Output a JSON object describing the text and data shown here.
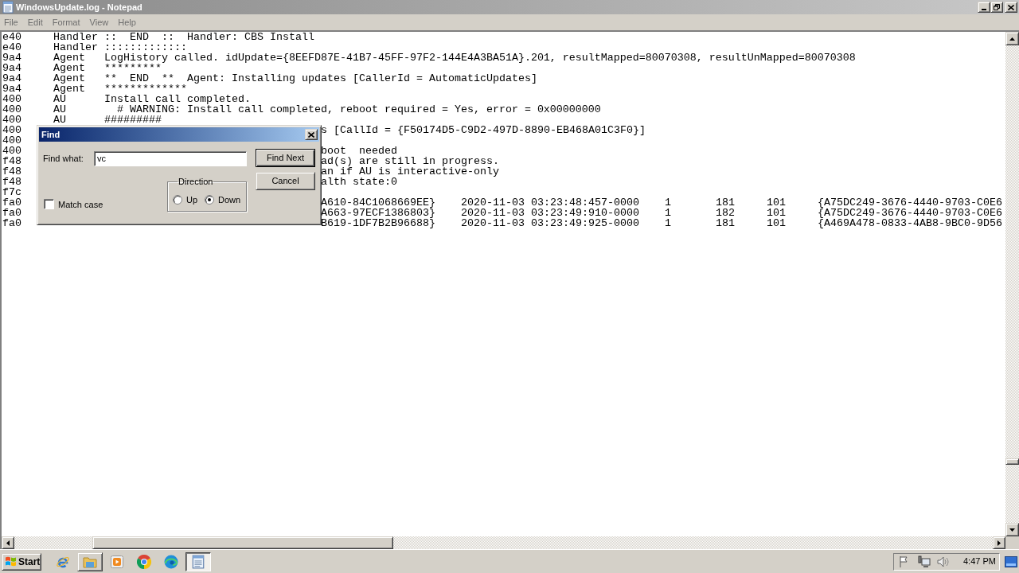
{
  "window": {
    "title": "WindowsUpdate.log - Notepad"
  },
  "menu": [
    "File",
    "Edit",
    "Format",
    "View",
    "Help"
  ],
  "log_lines": [
    {
      "thread": "e40",
      "component": "Handler",
      "message": "::  END  ::  Handler: CBS Install"
    },
    {
      "thread": "e40",
      "component": "Handler",
      "message": ":::::::::::::"
    },
    {
      "thread": "9a4",
      "component": "Agent",
      "message": "LogHistory called. idUpdate={8EEFD87E-41B7-45FF-97F2-144E4A3BA51A}.201, resultMapped=80070308, resultUnMapped=80070308"
    },
    {
      "thread": "9a4",
      "component": "Agent",
      "message": "*********"
    },
    {
      "thread": "9a4",
      "component": "Agent",
      "message": "**  END  **  Agent: Installing updates [CallerId = AutomaticUpdates]"
    },
    {
      "thread": "9a4",
      "component": "Agent",
      "message": "*************"
    },
    {
      "thread": "400",
      "component": "AU",
      "message": "Install call completed."
    },
    {
      "thread": "400",
      "component": "AU",
      "message": "  # WARNING: Install call completed, reboot required = Yes, error = 0x00000000"
    },
    {
      "thread": "400",
      "component": "AU",
      "message": "#########"
    },
    {
      "thread": "400",
      "tail": [
        "s [CallId = {F50174D5-C9D2-497D-8890-EB468A01C3F0}]"
      ]
    },
    {
      "thread": "400"
    },
    {
      "thread": "400",
      "tail": [
        "boot  needed"
      ]
    },
    {
      "thread": "f48",
      "tail": [
        "ad(s) are still in progress."
      ]
    },
    {
      "thread": "f48",
      "tail": [
        "an if AU is interactive-only"
      ]
    },
    {
      "thread": "f48",
      "tail": [
        "alth state:0"
      ]
    },
    {
      "thread": "f7c"
    },
    {
      "thread": "fa0",
      "tail": [
        "A610-84C1068669EE}",
        "2020-11-03 03:23:48:457-0000",
        "1",
        "181",
        "101",
        "{A75DC249-3676-4440-9703-C0E6"
      ]
    },
    {
      "thread": "fa0",
      "tail": [
        "A663-97ECF1386803}",
        "2020-11-03 03:23:49:910-0000",
        "1",
        "182",
        "101",
        "{A75DC249-3676-4440-9703-C0E6"
      ]
    },
    {
      "thread": "fa0",
      "tail": [
        "B619-1DF7B2B96688}",
        "2020-11-03 03:23:49:925-0000",
        "1",
        "181",
        "101",
        "{A469A478-0833-4AB8-9BC0-9D56"
      ]
    }
  ],
  "find_dialog": {
    "title": "Find",
    "find_what": {
      "label": "Find what:",
      "value": "vc"
    },
    "match_case": {
      "label": "Match case",
      "checked": false
    },
    "direction": {
      "label": "Direction",
      "options": [
        {
          "label": "Up",
          "selected": false
        },
        {
          "label": "Down",
          "selected": true
        }
      ]
    },
    "buttons": [
      {
        "label": "Find Next",
        "default": true
      },
      {
        "label": "Cancel",
        "default": false
      }
    ]
  },
  "taskbar": {
    "start": "Start",
    "buttons": [
      {
        "kind": "ie",
        "open": false,
        "selected": false
      },
      {
        "kind": "explorer",
        "open": true,
        "selected": false
      },
      {
        "kind": "media",
        "open": false,
        "selected": false
      },
      {
        "kind": "chrome",
        "open": false,
        "selected": false
      },
      {
        "kind": "edge",
        "open": false,
        "selected": false
      },
      {
        "kind": "notepad",
        "open": true,
        "selected": true
      }
    ],
    "clock": "4:47 PM"
  }
}
